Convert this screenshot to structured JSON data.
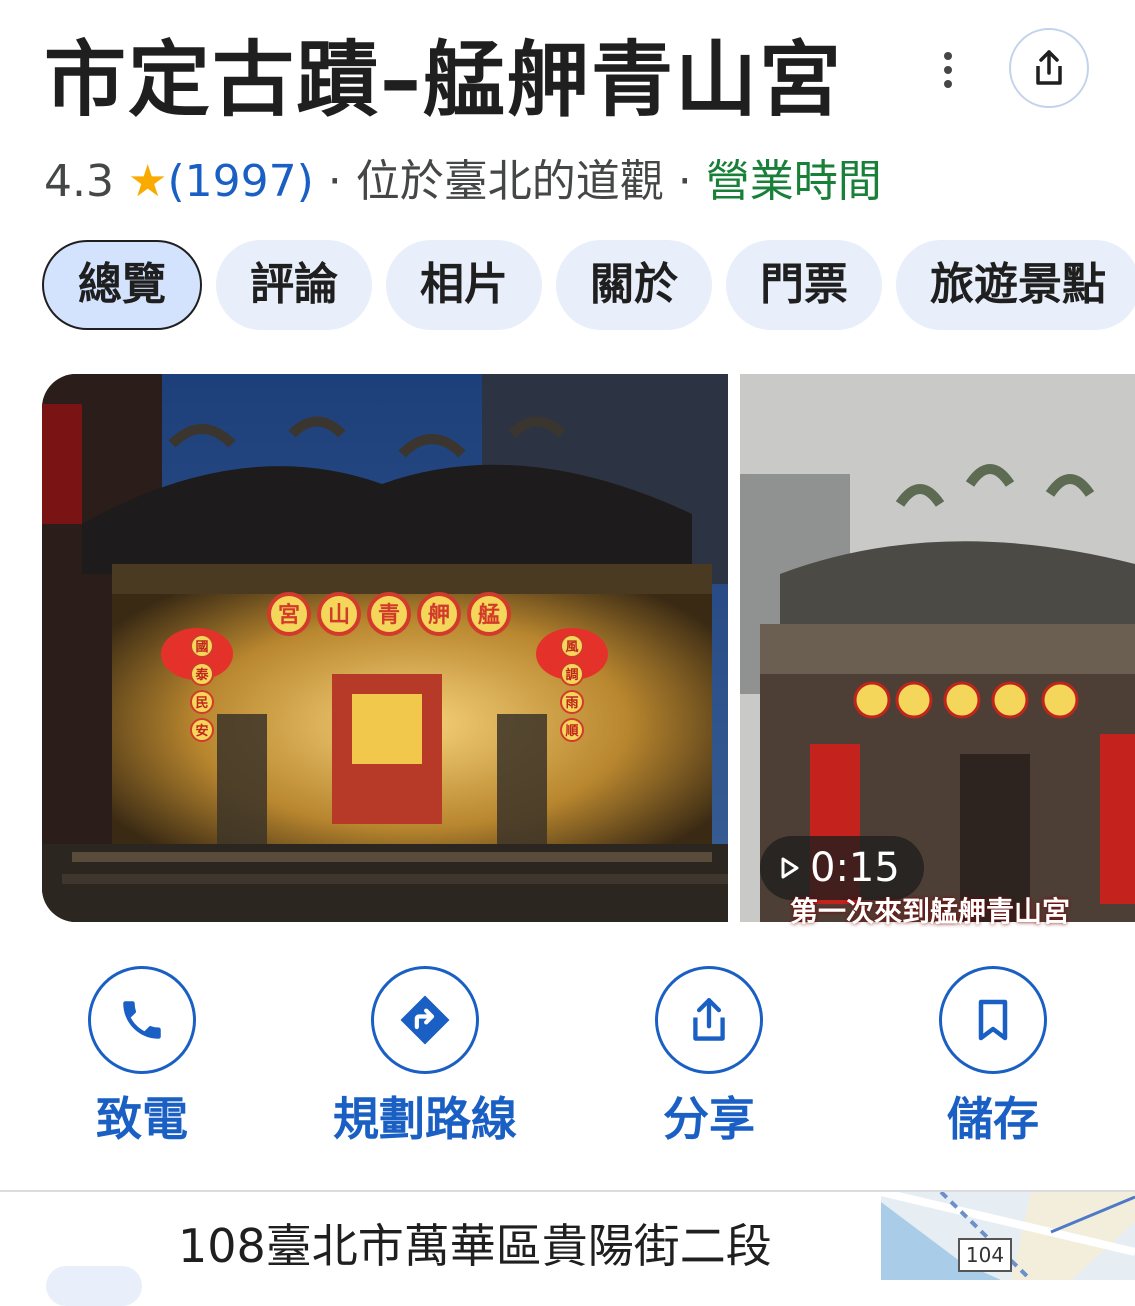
{
  "header": {
    "title": "市定古蹟–艋舺青山宮",
    "rating": "4.3",
    "review_count": "(1997)",
    "category": "位於臺北的道觀",
    "hours_link": "營業時間",
    "separator": "·"
  },
  "tabs": [
    {
      "label": "總覽",
      "active": true
    },
    {
      "label": "評論"
    },
    {
      "label": "相片"
    },
    {
      "label": "關於"
    },
    {
      "label": "門票"
    },
    {
      "label": "旅遊景點"
    }
  ],
  "photos": {
    "video_duration": "0:15",
    "video_caption": "第一次來到艋舺青山宮",
    "main_lantern_text": [
      "宮",
      "山",
      "青",
      "舺",
      "艋"
    ],
    "side_lantern_left": [
      "國",
      "泰",
      "民",
      "安"
    ],
    "side_lantern_right": [
      "風",
      "調",
      "雨",
      "順"
    ]
  },
  "actions": [
    {
      "label": "致電",
      "icon": "phone-icon"
    },
    {
      "label": "規劃路線",
      "icon": "directions-icon"
    },
    {
      "label": "分享",
      "icon": "share-icon"
    },
    {
      "label": "儲存",
      "icon": "bookmark-icon"
    }
  ],
  "address": {
    "text": "108臺北市萬華區貴陽街二段",
    "map_route_label": "104"
  },
  "colors": {
    "accent": "#1a5fc4",
    "open_green": "#188038",
    "star": "#f9ab00",
    "tab_bg": "#e8effa"
  }
}
